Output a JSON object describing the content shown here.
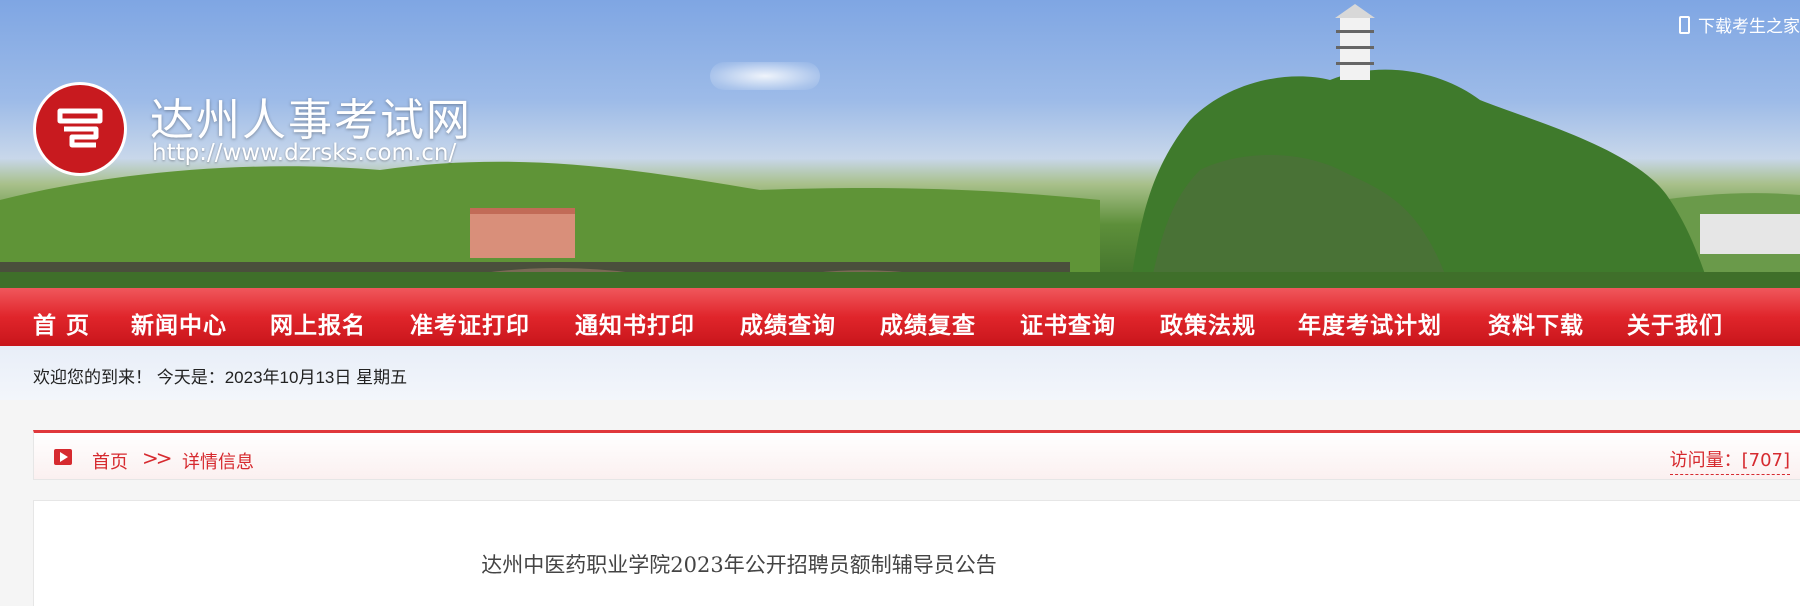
{
  "header": {
    "site_title": "达州人事考试网",
    "site_url": "http://www.dzrsks.com.cn/",
    "logo_text": "",
    "download_link": "下载考生之家"
  },
  "nav": {
    "items": [
      {
        "label": "首 页",
        "active": true
      },
      {
        "label": "新闻中心"
      },
      {
        "label": "网上报名"
      },
      {
        "label": "准考证打印"
      },
      {
        "label": "通知书打印"
      },
      {
        "label": "成绩查询"
      },
      {
        "label": "成绩复查"
      },
      {
        "label": "证书查询"
      },
      {
        "label": "政策法规"
      },
      {
        "label": "年度考试计划"
      },
      {
        "label": "资料下载"
      },
      {
        "label": "关于我们"
      }
    ]
  },
  "welcome": {
    "text": "欢迎您的到来！ 今天是：2023年10月13日 星期五"
  },
  "breadcrumb": {
    "home": "首页",
    "separator": ">>",
    "current": "详情信息",
    "visits": "访问量：[707]"
  },
  "article": {
    "title": "达州中医药职业学院2023年公开招聘员额制辅导员公告"
  },
  "colors": {
    "accent": "#d62a2f",
    "nav_red": "#e0252b"
  }
}
